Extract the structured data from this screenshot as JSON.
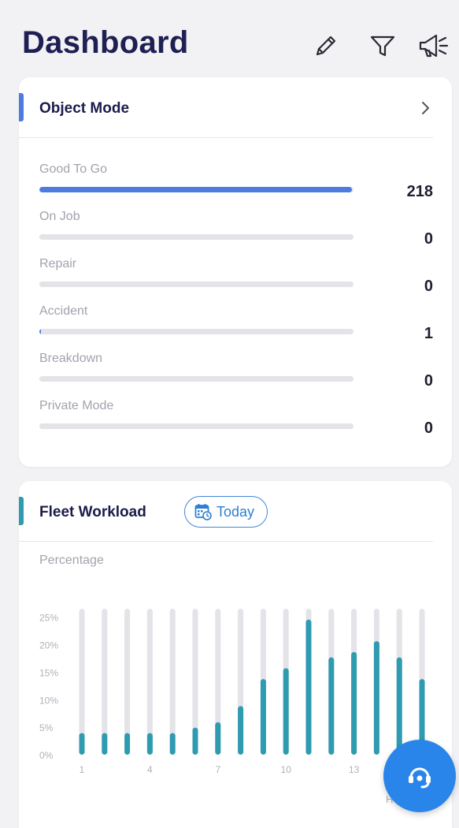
{
  "header": {
    "title": "Dashboard",
    "icons": [
      "pencil-icon",
      "filter-icon",
      "megaphone-icon"
    ]
  },
  "object_mode": {
    "title": "Object Mode",
    "accent_color": "#4d7be0",
    "max_value": 219,
    "items": [
      {
        "label": "Good To Go",
        "value": 218
      },
      {
        "label": "On Job",
        "value": 0
      },
      {
        "label": "Repair",
        "value": 0
      },
      {
        "label": "Accident",
        "value": 1
      },
      {
        "label": "Breakdown",
        "value": 0
      },
      {
        "label": "Private Mode",
        "value": 0
      }
    ]
  },
  "fleet_workload": {
    "title": "Fleet Workload",
    "accent_color": "#2e9bb0",
    "filter_label": "Today",
    "chart_label": "Percentage",
    "clipped_axis_text": "H"
  },
  "chart_data": {
    "type": "bar",
    "title": "",
    "ylabel": "Percentage",
    "ylim": [
      0,
      27
    ],
    "y_ticks": [
      "0%",
      "5%",
      "10%",
      "15%",
      "20%",
      "25%"
    ],
    "x_tick_labels": [
      {
        "x": 1,
        "label": "1"
      },
      {
        "x": 4,
        "label": "4"
      },
      {
        "x": 7,
        "label": "7"
      },
      {
        "x": 10,
        "label": "10"
      },
      {
        "x": 13,
        "label": "13"
      }
    ],
    "categories": [
      1,
      2,
      3,
      4,
      5,
      6,
      7,
      8,
      9,
      10,
      11,
      12,
      13,
      14,
      15,
      16
    ],
    "values": [
      4,
      4,
      4,
      4,
      4,
      5,
      6,
      9,
      14,
      16,
      25,
      18,
      19,
      21,
      18,
      14
    ],
    "bar_color": "#2e9bb0",
    "track_color": "#e3e3e8",
    "grid": false
  },
  "fab": {
    "icon": "support-agent-icon",
    "color": "#2a85ea"
  }
}
